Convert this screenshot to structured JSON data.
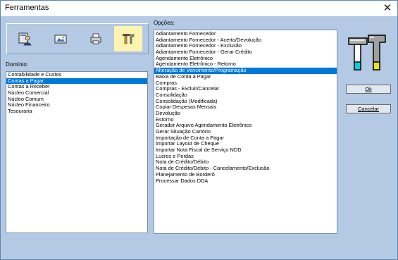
{
  "window": {
    "title": "Ferramentas",
    "close_glyph": "✕"
  },
  "toolbar": {
    "buttons": [
      {
        "icon": "user-icon",
        "selected": false
      },
      {
        "icon": "image-icon",
        "selected": false
      },
      {
        "icon": "printer-icon",
        "selected": false
      },
      {
        "icon": "tools-icon",
        "selected": true
      }
    ]
  },
  "dominio": {
    "label": "Domínio:",
    "items": [
      "Contabilidade e Custos",
      "Contas a Pagar",
      "Contas a Receber",
      "Núcleo Comercial",
      "Núcleo Comum",
      "Núcleo Financeiro",
      "Tesouraria"
    ],
    "selected": "Contas a Pagar"
  },
  "opcoes": {
    "label": "Opções:",
    "items": [
      "Adiantamento Fornecedor",
      "Adiantamento Fornecedor - Acerto/Devolução",
      "Adiantamento Fornecedor - Exclusão",
      "Adiantamento Fornecedor - Gerar Crédito",
      "Agendamento Eletrônico",
      "Agendamento Eletrônico - Retorno",
      "Alteração de Vencimento/Programação",
      "Baixa de Conta a Pagar",
      "Compras",
      "Compras - Excluir/Cancelar",
      "Consolidação",
      "Consolidação (Modificada)",
      "Copiar Despesas Mensais",
      "Devolução",
      "Estorno",
      "Gerador Arquivo Agendamento Eletrônico",
      "Gerar Situação Cartório",
      "Importação de Conta a Pagar",
      "Importar Layout de Cheque",
      "Importar Nota Fiscal de Serviço NDD",
      "Lucros e Perdas",
      "Nota de Crédito/Débito",
      "Nota de Crédito/Débito - Cancelamento/Exclusão",
      "Planejamento de Borderô",
      "Processar Dados DDA"
    ],
    "selected": "Alteração de Vencimento/Programação"
  },
  "actions": {
    "ok_label": "Ok",
    "cancel_label": "Cancelar"
  },
  "colors": {
    "selection": "#0078d7",
    "dialog_bg": "#b4c9e4",
    "selected_tool_bg": "#fff3b0"
  }
}
